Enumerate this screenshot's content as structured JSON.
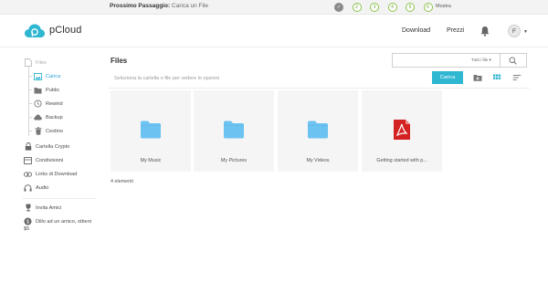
{
  "stepbar": {
    "label_bold": "Prossimo Passaggio:",
    "label_text": "Carica un File",
    "steps": [
      "✓",
      "2",
      "3",
      "4",
      "5",
      "6"
    ],
    "show_label": "Mostra"
  },
  "header": {
    "logo_text": "pCloud",
    "download_label": "Download",
    "prices_label": "Prezzi",
    "avatar_letter": "F"
  },
  "sidebar": {
    "files": "Files",
    "upload": "Carica",
    "public": "Public",
    "rewind": "Rewind",
    "backup": "Backup",
    "trash": "Cestino",
    "crypto": "Cartella Crypto",
    "shares": "Condivisioni",
    "download_links": "Links di Download",
    "audio": "Audio",
    "invite": "Invita Amici",
    "refer_line1": "Dillo ad un amico, ottieni",
    "refer_line2": "$5"
  },
  "main": {
    "title": "Files",
    "search_placeholder": "",
    "filter_label": "Tutti i file",
    "hint": "Seleziona la cartella o file per vedere le opzioni",
    "upload_button": "Carica",
    "items": [
      {
        "name": "My Music",
        "type": "folder"
      },
      {
        "name": "My Pictures",
        "type": "folder"
      },
      {
        "name": "My Videos",
        "type": "folder"
      },
      {
        "name": "Getting started with p...",
        "type": "pdf"
      }
    ],
    "count": "4 elementi"
  },
  "colors": {
    "accent": "#2fb6d1",
    "folder": "#6cc3f2",
    "pdf": "#d32222",
    "step_green": "#8bc34a"
  }
}
